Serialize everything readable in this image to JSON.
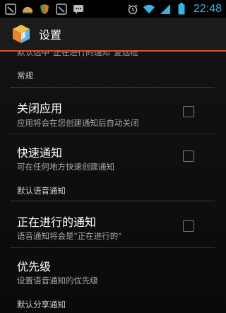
{
  "status_bar": {
    "time": "22:48",
    "left_icons": [
      "usb-debug-icon",
      "bag-icon",
      "shield-icon",
      "usb-debug-icon-2",
      "chat-icon"
    ],
    "right_icons": [
      "alarm-icon",
      "wifi-icon",
      "signal-icon",
      "battery-icon"
    ],
    "accent": "#33b5e5"
  },
  "action_bar": {
    "title": "设置",
    "accent_line": "#d2542a"
  },
  "partial_top_text": "默认选中\"正在进行的通知\"复选框",
  "sections": [
    {
      "header": "常规",
      "items": [
        {
          "title": "关闭应用",
          "summary": "应用将会在您创建通知后自动关闭",
          "checked": false
        },
        {
          "title": "快速通知",
          "summary": "可在任何地方快速创建通知",
          "checked": false
        }
      ]
    },
    {
      "header": "默认语音通知",
      "items": [
        {
          "title": "正在进行的通知",
          "summary": "语音通知将会是\"正在进行的\"",
          "checked": false
        },
        {
          "title": "优先级",
          "summary": "设置语音通知的优先级"
        }
      ]
    },
    {
      "header": "默认分享通知",
      "items": []
    }
  ]
}
